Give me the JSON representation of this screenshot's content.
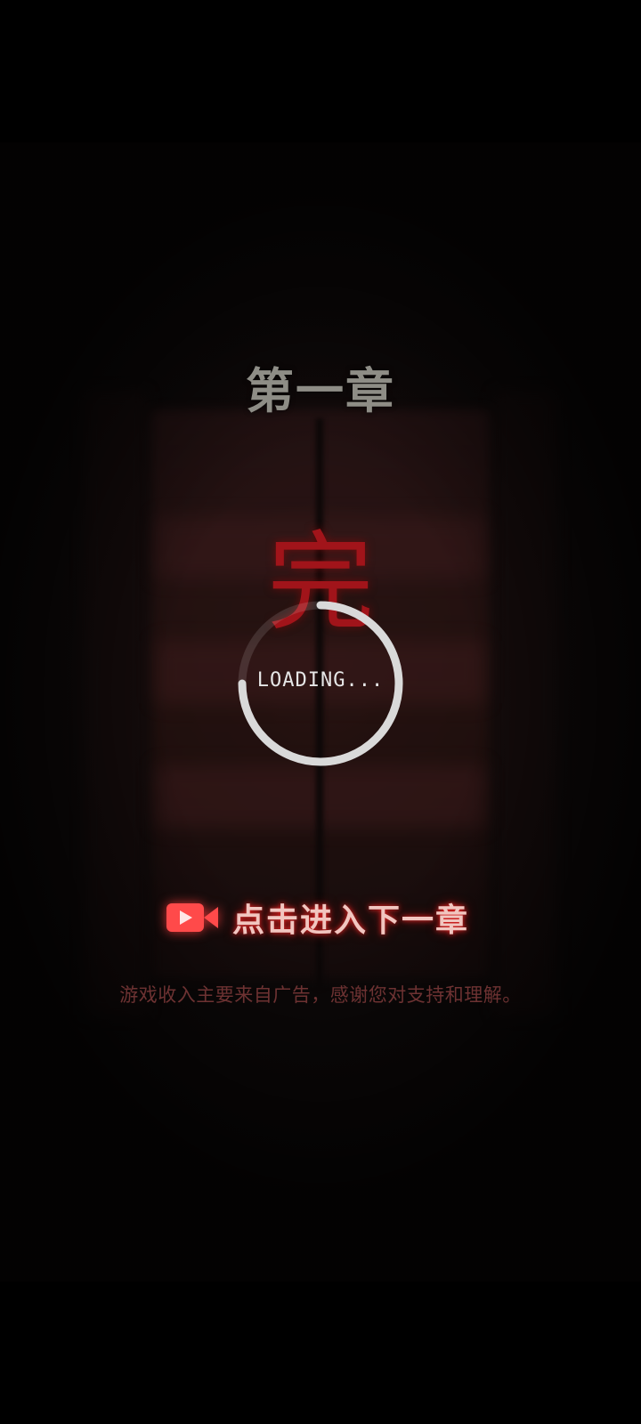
{
  "chapter": {
    "title": "第一章",
    "end_char": "完"
  },
  "loading": {
    "text": "LOADING..."
  },
  "next_chapter": {
    "icon": "video-play-icon",
    "label": "点击进入下一章"
  },
  "notice": {
    "text": "游戏收入主要来自广告，感谢您对支持和理解。"
  },
  "colors": {
    "title": "#8e8d86",
    "accent_red": "#a1141a",
    "button_glow": "#ff3c3c",
    "notice": "#6d3232"
  }
}
